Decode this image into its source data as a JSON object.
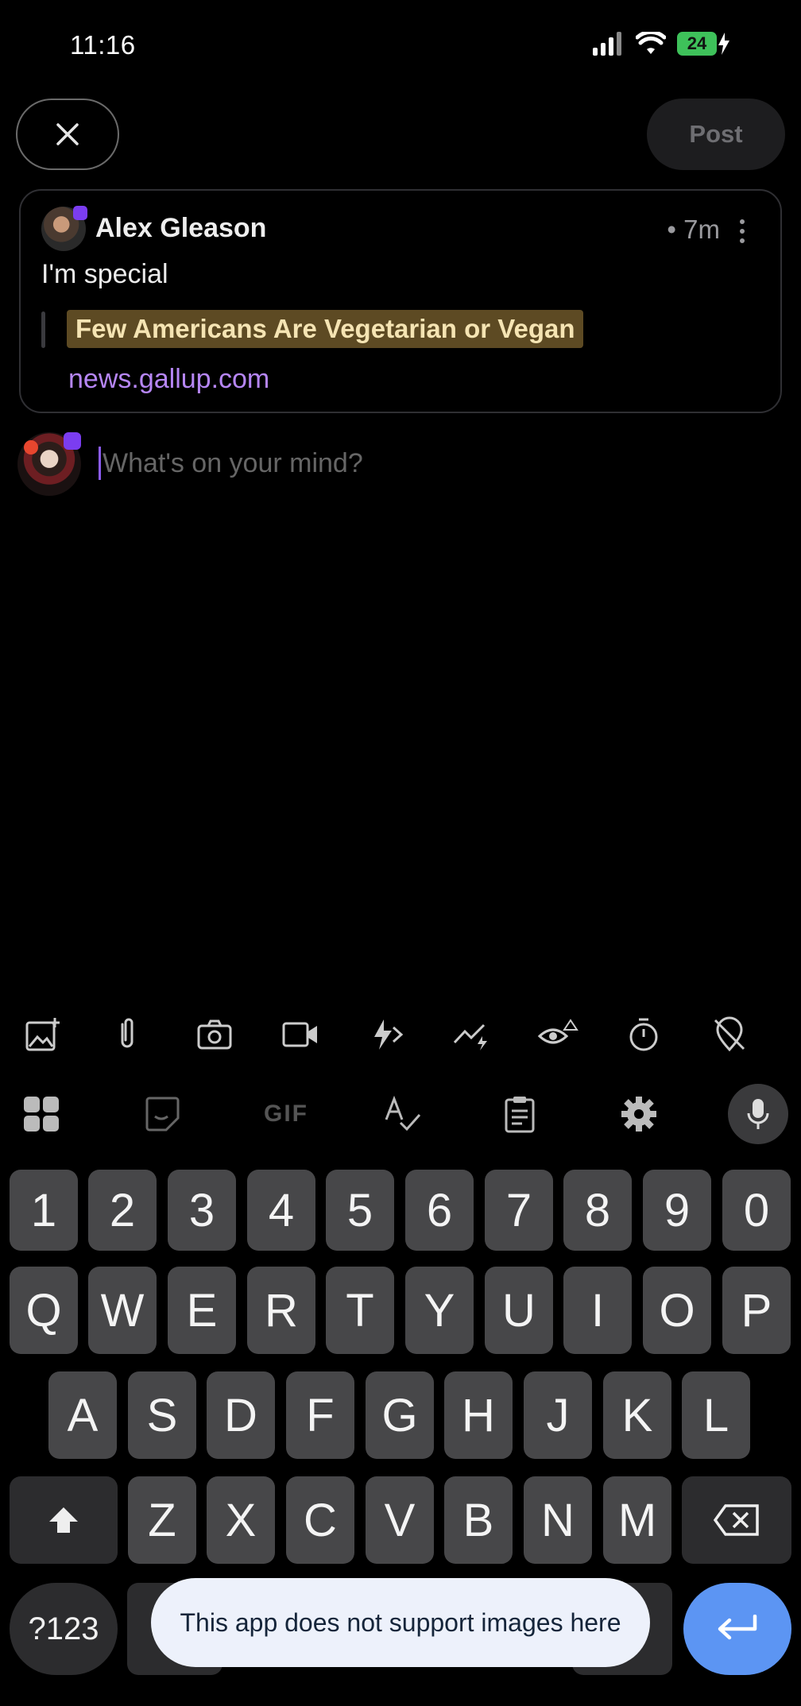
{
  "status_bar": {
    "time": "11:16",
    "battery": "24"
  },
  "header": {
    "post_label": "Post"
  },
  "quoted_post": {
    "author": "Alex Gleason",
    "time": "• 7m",
    "text": "I'm special",
    "link_title": "Few Americans Are Vegetarian or Vegan",
    "link_domain": "news.gallup.com"
  },
  "composer": {
    "placeholder": "What's on your mind?"
  },
  "toolbar": {
    "icons": [
      "add-image-icon",
      "attachment-icon",
      "camera-icon",
      "video-icon",
      "zap-icon",
      "trend-icon",
      "content-warning-icon",
      "timer-icon",
      "location-off-icon"
    ]
  },
  "keyboard": {
    "top_icons": [
      "apps-grid-icon",
      "sticker-icon",
      "gif-icon",
      "spellcheck-icon",
      "clipboard-icon",
      "settings-icon",
      "microphone-icon"
    ],
    "gif_label": "GIF",
    "number_row": [
      "1",
      "2",
      "3",
      "4",
      "5",
      "6",
      "7",
      "8",
      "9",
      "0"
    ],
    "row1": [
      "Q",
      "W",
      "E",
      "R",
      "T",
      "Y",
      "U",
      "I",
      "O",
      "P"
    ],
    "row2": [
      "A",
      "S",
      "D",
      "F",
      "G",
      "H",
      "J",
      "K",
      "L"
    ],
    "row3": [
      "Z",
      "X",
      "C",
      "V",
      "B",
      "N",
      "M"
    ],
    "symbols_label": "?123"
  },
  "toast": {
    "message": "This app does not support images here"
  },
  "colors": {
    "accent": "#8c5cf5",
    "link": "#b686f5",
    "highlight_bg": "#5d4a23",
    "enter_key": "#5c95f3"
  }
}
